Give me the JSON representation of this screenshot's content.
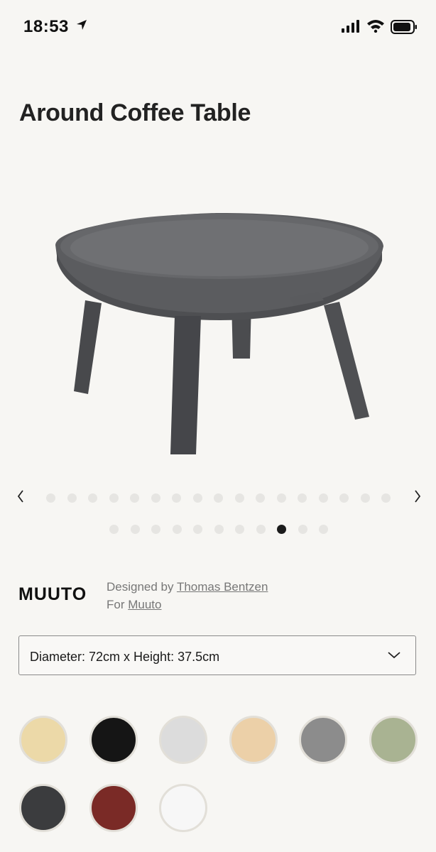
{
  "status_bar": {
    "time": "18:53",
    "location_icon": "location-arrow-icon",
    "signal_icon": "cellular-signal-icon",
    "wifi_icon": "wifi-icon",
    "battery_icon": "battery-icon"
  },
  "product": {
    "title": "Around Coffee Table",
    "image_icon": "coffee-table-image"
  },
  "carousel": {
    "prev_label": "‹",
    "next_label": "›",
    "dot_count": 28,
    "active_dot": 25
  },
  "brand": {
    "logo": "MUUTO",
    "designed_by_prefix": "Designed by",
    "designer_name": "Thomas Bentzen",
    "for_prefix": "For",
    "brand_link": "Muuto"
  },
  "size_select": {
    "value": "Diameter: 72cm x Height: 37.5cm",
    "chevron_icon": "chevron-down-icon"
  },
  "swatches": [
    {
      "name": "natural-ash",
      "color": "#ecd9a8"
    },
    {
      "name": "black",
      "color": "#151515"
    },
    {
      "name": "light-grey",
      "color": "#dcdcdc"
    },
    {
      "name": "oak",
      "color": "#ecd0a8"
    },
    {
      "name": "grey",
      "color": "#8c8c8c"
    },
    {
      "name": "green",
      "color": "#a9b392"
    },
    {
      "name": "anthracite",
      "color": "#3b3c3e"
    },
    {
      "name": "dusty-red",
      "color": "#7a2a26"
    },
    {
      "name": "white",
      "color": "#f7f7f7"
    }
  ],
  "colors": {
    "background": "#f7f6f3",
    "dot_inactive": "#e6e5e2",
    "dot_active": "#1b1b1b",
    "link_text": "#777777",
    "table_grey": "#5f6063"
  }
}
